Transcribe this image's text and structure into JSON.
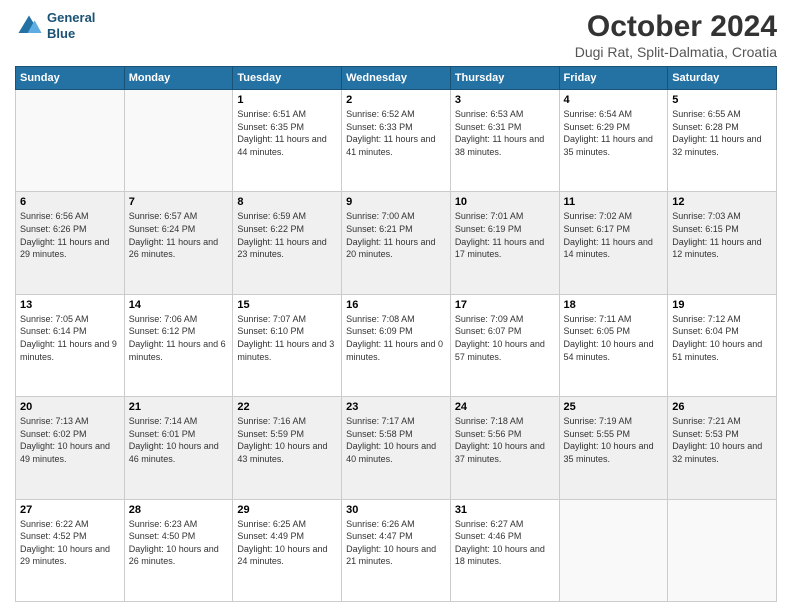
{
  "header": {
    "logo_line1": "General",
    "logo_line2": "Blue",
    "main_title": "October 2024",
    "subtitle": "Dugi Rat, Split-Dalmatia, Croatia"
  },
  "calendar": {
    "weekdays": [
      "Sunday",
      "Monday",
      "Tuesday",
      "Wednesday",
      "Thursday",
      "Friday",
      "Saturday"
    ],
    "weeks": [
      [
        {
          "day": "",
          "info": ""
        },
        {
          "day": "",
          "info": ""
        },
        {
          "day": "1",
          "info": "Sunrise: 6:51 AM\nSunset: 6:35 PM\nDaylight: 11 hours and 44 minutes."
        },
        {
          "day": "2",
          "info": "Sunrise: 6:52 AM\nSunset: 6:33 PM\nDaylight: 11 hours and 41 minutes."
        },
        {
          "day": "3",
          "info": "Sunrise: 6:53 AM\nSunset: 6:31 PM\nDaylight: 11 hours and 38 minutes."
        },
        {
          "day": "4",
          "info": "Sunrise: 6:54 AM\nSunset: 6:29 PM\nDaylight: 11 hours and 35 minutes."
        },
        {
          "day": "5",
          "info": "Sunrise: 6:55 AM\nSunset: 6:28 PM\nDaylight: 11 hours and 32 minutes."
        }
      ],
      [
        {
          "day": "6",
          "info": "Sunrise: 6:56 AM\nSunset: 6:26 PM\nDaylight: 11 hours and 29 minutes."
        },
        {
          "day": "7",
          "info": "Sunrise: 6:57 AM\nSunset: 6:24 PM\nDaylight: 11 hours and 26 minutes."
        },
        {
          "day": "8",
          "info": "Sunrise: 6:59 AM\nSunset: 6:22 PM\nDaylight: 11 hours and 23 minutes."
        },
        {
          "day": "9",
          "info": "Sunrise: 7:00 AM\nSunset: 6:21 PM\nDaylight: 11 hours and 20 minutes."
        },
        {
          "day": "10",
          "info": "Sunrise: 7:01 AM\nSunset: 6:19 PM\nDaylight: 11 hours and 17 minutes."
        },
        {
          "day": "11",
          "info": "Sunrise: 7:02 AM\nSunset: 6:17 PM\nDaylight: 11 hours and 14 minutes."
        },
        {
          "day": "12",
          "info": "Sunrise: 7:03 AM\nSunset: 6:15 PM\nDaylight: 11 hours and 12 minutes."
        }
      ],
      [
        {
          "day": "13",
          "info": "Sunrise: 7:05 AM\nSunset: 6:14 PM\nDaylight: 11 hours and 9 minutes."
        },
        {
          "day": "14",
          "info": "Sunrise: 7:06 AM\nSunset: 6:12 PM\nDaylight: 11 hours and 6 minutes."
        },
        {
          "day": "15",
          "info": "Sunrise: 7:07 AM\nSunset: 6:10 PM\nDaylight: 11 hours and 3 minutes."
        },
        {
          "day": "16",
          "info": "Sunrise: 7:08 AM\nSunset: 6:09 PM\nDaylight: 11 hours and 0 minutes."
        },
        {
          "day": "17",
          "info": "Sunrise: 7:09 AM\nSunset: 6:07 PM\nDaylight: 10 hours and 57 minutes."
        },
        {
          "day": "18",
          "info": "Sunrise: 7:11 AM\nSunset: 6:05 PM\nDaylight: 10 hours and 54 minutes."
        },
        {
          "day": "19",
          "info": "Sunrise: 7:12 AM\nSunset: 6:04 PM\nDaylight: 10 hours and 51 minutes."
        }
      ],
      [
        {
          "day": "20",
          "info": "Sunrise: 7:13 AM\nSunset: 6:02 PM\nDaylight: 10 hours and 49 minutes."
        },
        {
          "day": "21",
          "info": "Sunrise: 7:14 AM\nSunset: 6:01 PM\nDaylight: 10 hours and 46 minutes."
        },
        {
          "day": "22",
          "info": "Sunrise: 7:16 AM\nSunset: 5:59 PM\nDaylight: 10 hours and 43 minutes."
        },
        {
          "day": "23",
          "info": "Sunrise: 7:17 AM\nSunset: 5:58 PM\nDaylight: 10 hours and 40 minutes."
        },
        {
          "day": "24",
          "info": "Sunrise: 7:18 AM\nSunset: 5:56 PM\nDaylight: 10 hours and 37 minutes."
        },
        {
          "day": "25",
          "info": "Sunrise: 7:19 AM\nSunset: 5:55 PM\nDaylight: 10 hours and 35 minutes."
        },
        {
          "day": "26",
          "info": "Sunrise: 7:21 AM\nSunset: 5:53 PM\nDaylight: 10 hours and 32 minutes."
        }
      ],
      [
        {
          "day": "27",
          "info": "Sunrise: 6:22 AM\nSunset: 4:52 PM\nDaylight: 10 hours and 29 minutes."
        },
        {
          "day": "28",
          "info": "Sunrise: 6:23 AM\nSunset: 4:50 PM\nDaylight: 10 hours and 26 minutes."
        },
        {
          "day": "29",
          "info": "Sunrise: 6:25 AM\nSunset: 4:49 PM\nDaylight: 10 hours and 24 minutes."
        },
        {
          "day": "30",
          "info": "Sunrise: 6:26 AM\nSunset: 4:47 PM\nDaylight: 10 hours and 21 minutes."
        },
        {
          "day": "31",
          "info": "Sunrise: 6:27 AM\nSunset: 4:46 PM\nDaylight: 10 hours and 18 minutes."
        },
        {
          "day": "",
          "info": ""
        },
        {
          "day": "",
          "info": ""
        }
      ]
    ]
  }
}
